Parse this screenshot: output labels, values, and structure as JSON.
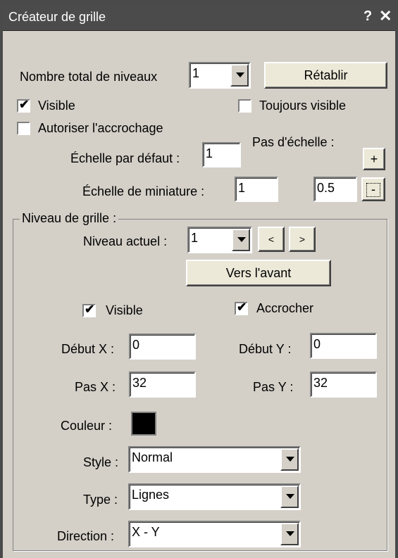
{
  "window": {
    "title": "Créateur de grille",
    "help": "?",
    "close": "✕"
  },
  "levels": {
    "label": "Nombre total de niveaux",
    "value": "1",
    "reset_label": "Rétablir"
  },
  "visible": {
    "label": "Visible",
    "checked": true
  },
  "always_visible": {
    "label": "Toujours visible",
    "checked": false
  },
  "allow_snap": {
    "label": "Autoriser l'accrochage",
    "checked": false
  },
  "default_scale": {
    "label": "Échelle par défaut :",
    "value": "1"
  },
  "scale_step": {
    "label": "Pas d'échelle :",
    "value": "0.5",
    "plus": "+",
    "minus": "-"
  },
  "thumb_scale": {
    "label": "Échelle de miniature :",
    "value": "1"
  },
  "grid_level": {
    "group_label": "Niveau de grille :",
    "current_label": "Niveau actuel :",
    "current_value": "1",
    "prev": "<",
    "next": ">",
    "forward_label": "Vers l'avant",
    "visible_label": "Visible",
    "visible_checked": true,
    "snap_label": "Accrocher",
    "snap_checked": true,
    "start_x_label": "Début X :",
    "start_x": "0",
    "start_y_label": "Début Y :",
    "start_y": "0",
    "step_x_label": "Pas X :",
    "step_x": "32",
    "step_y_label": "Pas Y :",
    "step_y": "32",
    "color_label": "Couleur :",
    "color": "#000000",
    "style_label": "Style :",
    "style_value": "Normal",
    "type_label": "Type :",
    "type_value": "Lignes",
    "direction_label": "Direction :",
    "direction_value": "X - Y"
  }
}
